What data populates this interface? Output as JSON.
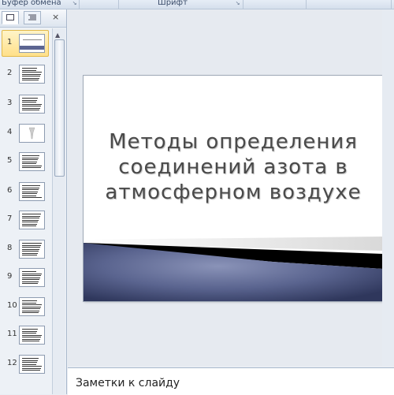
{
  "ribbon": {
    "clipboard_group": "Буфер обмена",
    "font_group": "Шрифт"
  },
  "slides_panel": {
    "tabs": [
      "slides-tab",
      "outline-tab"
    ],
    "items": [
      {
        "number": "1",
        "selected": true
      },
      {
        "number": "2"
      },
      {
        "number": "3"
      },
      {
        "number": "4"
      },
      {
        "number": "5"
      },
      {
        "number": "6"
      },
      {
        "number": "7"
      },
      {
        "number": "8"
      },
      {
        "number": "9"
      },
      {
        "number": "10"
      },
      {
        "number": "11"
      },
      {
        "number": "12"
      }
    ]
  },
  "slide": {
    "title": "Методы определения\nсоединений азота в\nатмосферном воздухе"
  },
  "notes": {
    "placeholder": "Заметки к слайду"
  },
  "colors": {
    "selection": "#ffe08a",
    "accent_band": "#4f5a86"
  }
}
